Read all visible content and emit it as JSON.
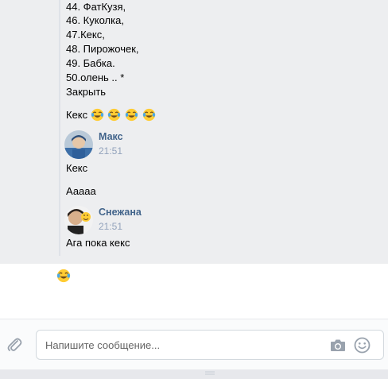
{
  "message_block": {
    "list_lines": [
      "44. ФатКузя,",
      "46. Куколка,",
      "47.Кекс,",
      "48. Пирожочек,",
      "49. Бабка.",
      "50.олень .. *",
      "Закрыть"
    ],
    "keks_text": "Кекс"
  },
  "messages": [
    {
      "author": "Макс",
      "time": "21:51",
      "texts": [
        "Кекс",
        "Ааааа"
      ]
    },
    {
      "author": "Снежана",
      "time": "21:51",
      "texts": [
        "Ага пока кекс"
      ]
    }
  ],
  "composer": {
    "placeholder": "Напишите сообщение..."
  },
  "icons": {
    "attach": "paperclip-icon",
    "camera": "camera-icon",
    "smile": "smile-icon",
    "emoji": "tears-of-joy-emoji"
  },
  "colors": {
    "author": "#42648b",
    "time": "#93a3bc",
    "chat_background": "#edeef0"
  }
}
